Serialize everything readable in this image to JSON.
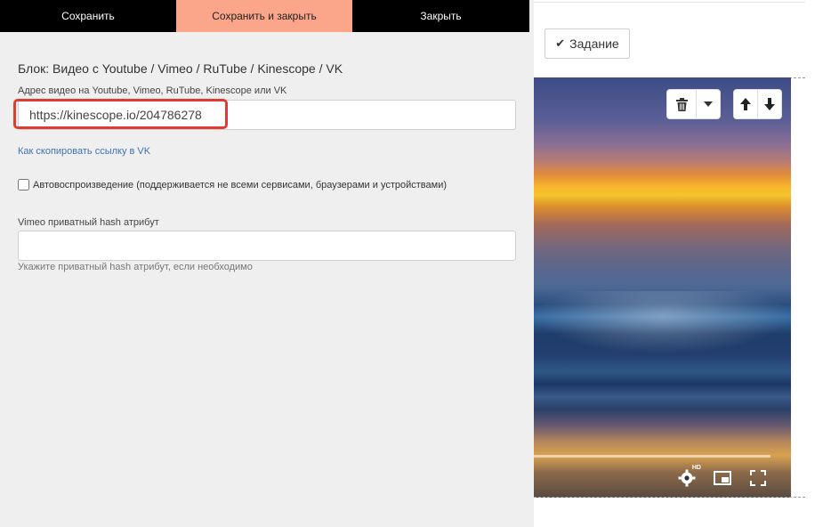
{
  "toolbar": {
    "save_label": "Сохранить",
    "save_close_label": "Сохранить и закрыть",
    "close_label": "Закрыть"
  },
  "form": {
    "block_title": "Блок: Видео с Youtube / Vimeo / RuTube / Kinescope / VK",
    "url_label": "Адрес видео на Youtube, Vimeo, RuTube, Kinescope или VK",
    "url_value": "https://kinescope.io/204786278",
    "copy_link_text": "Как скопировать ссылку в VK",
    "autoplay_label": "Автовоспроизведение (поддерживается не всеми сервисами, браузерами и устройствами)",
    "autoplay_checked": false,
    "hash_label": "Vimeo приватный hash атрибут",
    "hash_value": "",
    "hash_hint": "Укажите приватный hash атрибут, если необходимо"
  },
  "background": {
    "task_button_label": "Задание",
    "task_icon": "check-icon",
    "block_controls": [
      "trash-icon",
      "caret-down-icon",
      "arrow-up-icon",
      "arrow-down-icon"
    ],
    "video_controls": [
      "settings-hd-icon",
      "picture-in-picture-icon",
      "fullscreen-icon"
    ],
    "hd_badge": "HD"
  },
  "colors": {
    "toolbar_bg": "#000000",
    "save_close_bg": "#fba58a",
    "panel_bg": "#efefef",
    "highlight": "#e03b33",
    "link": "#3f72b7"
  }
}
